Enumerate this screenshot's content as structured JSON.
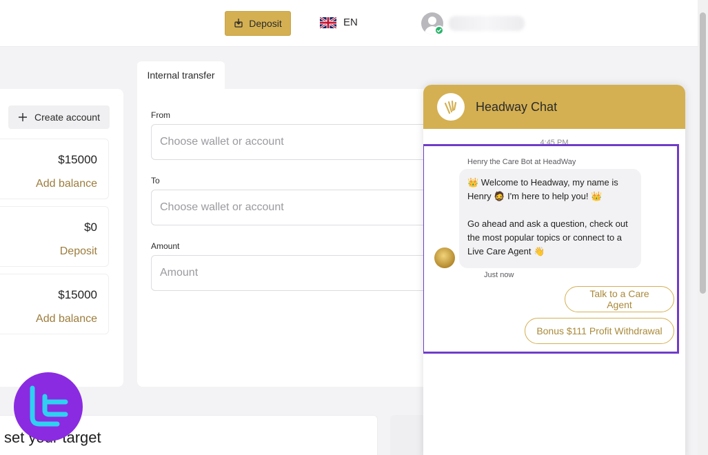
{
  "header": {
    "deposit_label": "Deposit",
    "language": "EN",
    "user_verified": true
  },
  "accounts": {
    "create_label": "Create account",
    "items": [
      {
        "amount": "$15000",
        "action": "Add balance"
      },
      {
        "amount": "$0",
        "action": "Deposit"
      },
      {
        "amount": "$15000",
        "action": "Add balance"
      }
    ]
  },
  "transfer": {
    "tab_label": "Internal transfer",
    "from_label": "From",
    "from_placeholder": "Choose wallet or account",
    "to_label": "To",
    "to_placeholder": "Choose wallet or account",
    "amount_label": "Amount",
    "amount_placeholder": "Amount"
  },
  "bottom": {
    "target_text": "set your target"
  },
  "chat": {
    "title": "Headway Chat",
    "time": "4:45 PM",
    "sender": "Henry the Care Bot at HeadWay",
    "message_line1": "👑 Welcome to Headway, my name is Henry 🧔 I'm here to help you! 👑",
    "message_line2": "Go ahead and ask a question, check out the most popular topics or connect to a Live Care Agent 👋",
    "status": "Just now",
    "quick_replies": [
      "Talk to a Care Agent",
      "Bonus $111 Profit Withdrawal"
    ]
  },
  "colors": {
    "accent_gold": "#d4b052",
    "link_gold": "#9c7c3c",
    "highlight_purple": "#6f3cc8",
    "logo_purple": "#8a2be2",
    "logo_cyan": "#2fd0f0"
  },
  "icons": {
    "deposit": "download-icon",
    "language_flag": "uk-flag-icon",
    "avatar": "user-avatar-icon",
    "verified": "check-icon",
    "create": "plus-icon",
    "chat_logo": "headway-logo-icon",
    "bot_avatar": "bot-avatar-icon",
    "watermark": "tc-logo-icon"
  }
}
